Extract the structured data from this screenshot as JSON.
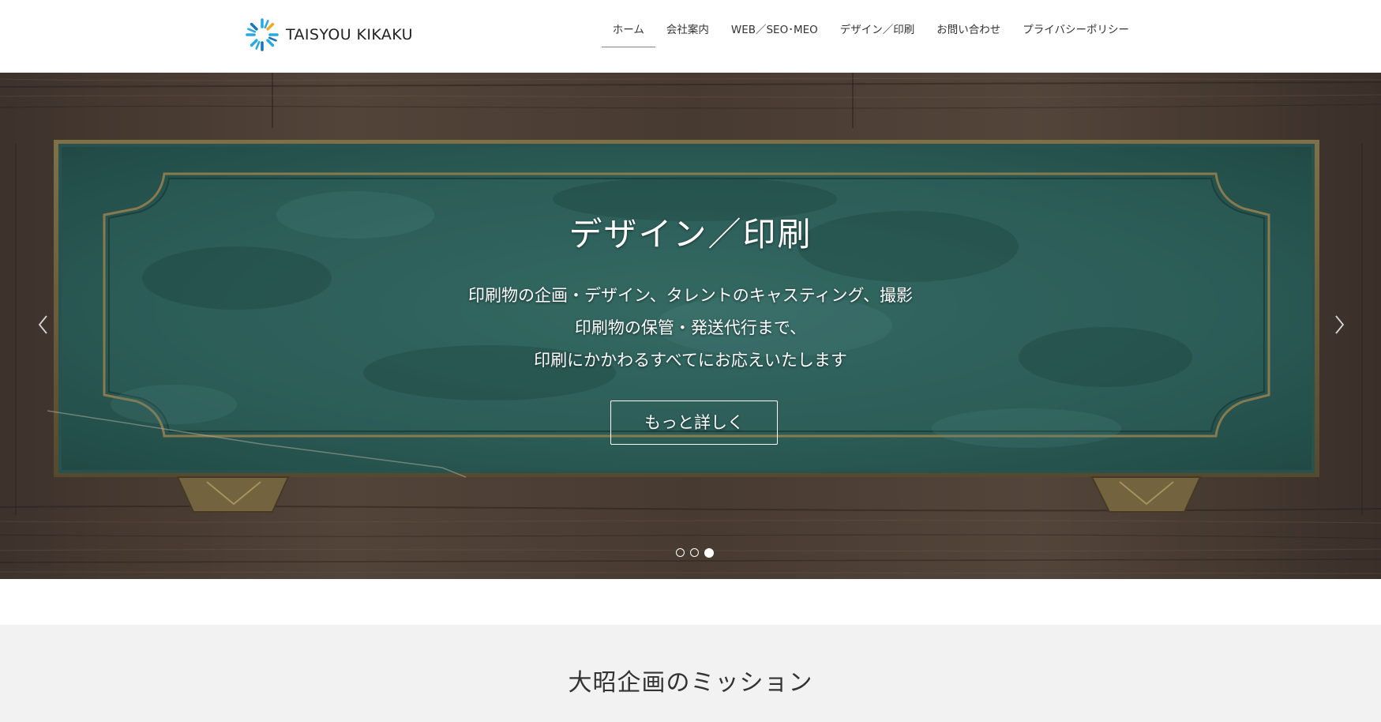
{
  "header": {
    "logo_text": "TAISYOU KIKAKU",
    "nav": [
      {
        "label": "ホーム",
        "active": true
      },
      {
        "label": "会社案内"
      },
      {
        "label": "WEB／SEO･MEO"
      },
      {
        "label": "デザイン／印刷"
      },
      {
        "label": "お問い合わせ"
      },
      {
        "label": "プライバシーポリシー"
      }
    ]
  },
  "hero": {
    "title": "デザイン／印刷",
    "lines": [
      "印刷物の企画・デザイン、タレントのキャスティング、撮影",
      "印刷物の保管・発送代行まで、",
      "印刷にかかわるすべてにお応えいたします"
    ],
    "button_label": "もっと詳しく",
    "slides_count": 3,
    "active_slide": 3
  },
  "mission": {
    "title": "大昭企画のミッション"
  },
  "colors": {
    "logo_blue": "#29a9e1",
    "logo_navy": "#1b75bb",
    "logo_orange": "#f7a823",
    "plaque_teal": "#336a64",
    "wood_brown": "#4d4036",
    "section_gray": "#f2f2f2"
  },
  "icons": {
    "logo": "sunburst-logo-icon",
    "prev": "chevron-left-icon",
    "next": "chevron-right-icon"
  }
}
